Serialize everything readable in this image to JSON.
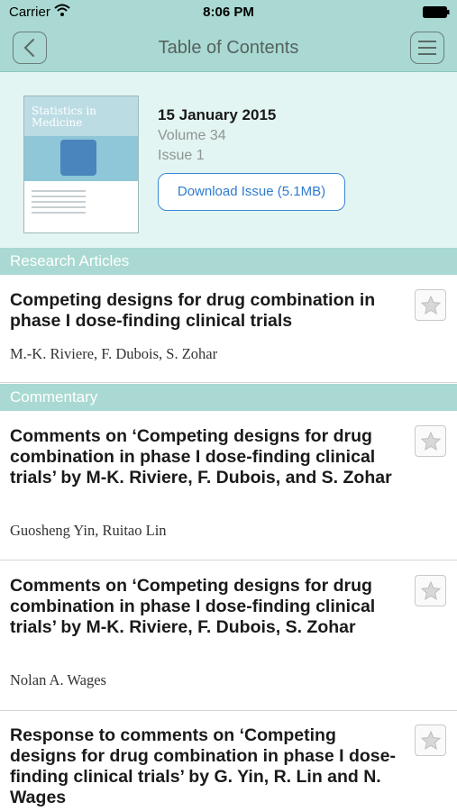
{
  "status_bar": {
    "carrier": "Carrier",
    "time": "8:06 PM"
  },
  "nav": {
    "title": "Table of Contents"
  },
  "issue": {
    "cover_title": "Statistics in Medicine",
    "date": "15 January 2015",
    "volume": "Volume 34",
    "issue": "Issue 1",
    "download_label": "Download Issue (5.1MB)"
  },
  "sections": [
    {
      "title": "Research Articles",
      "articles": [
        {
          "title": "Competing designs for drug combination in phase I dose-finding clinical trials",
          "authors": "M.-K. Riviere, F. Dubois, S. Zohar"
        }
      ]
    },
    {
      "title": "Commentary",
      "articles": [
        {
          "title": "Comments on ‘Competing designs for drug combination in phase I dose-finding clinical trials’ by M-K. Riviere, F. Dubois, and S. Zohar",
          "authors": "Guosheng Yin, Ruitao Lin"
        },
        {
          "title": "Comments on ‘Competing designs for drug combination in phase I dose-finding clinical trials’ by M-K. Riviere, F. Dubois, S. Zohar",
          "authors": "Nolan A. Wages"
        },
        {
          "title": "Response to comments on ‘Competing designs for drug combination in phase I dose-finding clinical trials’ by G. Yin, R. Lin and N. Wages",
          "authors": ""
        }
      ]
    }
  ],
  "icons": {
    "back": "chevron-left-icon",
    "menu": "hamburger-menu-icon",
    "favorite": "star-icon",
    "wifi": "wifi-icon",
    "battery": "battery-icon"
  },
  "colors": {
    "accent": "#a9d9d2",
    "header_bg": "#e3f5f2",
    "link_blue": "#2f7bd0"
  }
}
